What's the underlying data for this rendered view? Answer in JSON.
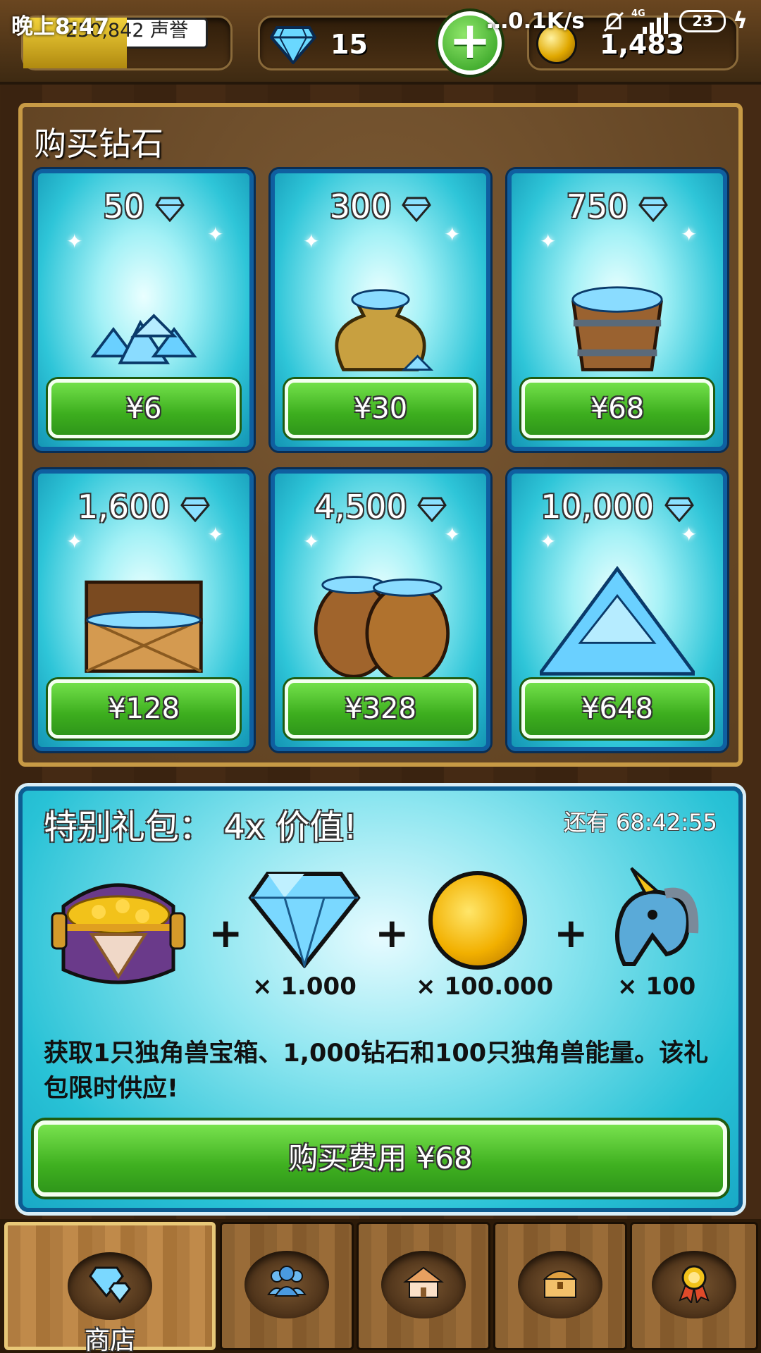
{
  "status_bar": {
    "time": "晚上8:47",
    "net_speed": "…0.1K/s",
    "network": "4G",
    "battery": "23"
  },
  "hud": {
    "reputation_value": "250,842",
    "reputation_label": "声誉",
    "reputation_progress": 0.5,
    "diamonds": "15",
    "coins": "1,483"
  },
  "shop": {
    "title": "购买钻石",
    "packs": [
      {
        "amount": "50",
        "price": "¥6",
        "art": "diamond-pile"
      },
      {
        "amount": "300",
        "price": "¥30",
        "art": "diamond-sack"
      },
      {
        "amount": "750",
        "price": "¥68",
        "art": "diamond-bucket"
      },
      {
        "amount": "1,600",
        "price": "¥128",
        "art": "treasure-chest"
      },
      {
        "amount": "4,500",
        "price": "¥328",
        "art": "barrels"
      },
      {
        "amount": "10,000",
        "price": "¥648",
        "art": "diamond-mountain"
      }
    ]
  },
  "special": {
    "title": "特别礼包：  4x 价值!",
    "timer": "还有 68:42:55",
    "items": [
      {
        "icon": "unicorn-chest-icon",
        "qty": ""
      },
      {
        "icon": "diamond-icon",
        "qty": "× 1.000"
      },
      {
        "icon": "gold-coin-icon",
        "qty": "× 100.000"
      },
      {
        "icon": "unicorn-icon",
        "qty": "× 100"
      }
    ],
    "description": "获取1只独角兽宝箱、1,000钻石和100只独角兽能量。该礼包限时供应!",
    "buy_label": "购买费用 ¥68"
  },
  "nav": {
    "tabs": [
      {
        "icon": "shop-diamond-icon",
        "label": "商店",
        "active": true
      },
      {
        "icon": "people-icon",
        "label": "",
        "active": false
      },
      {
        "icon": "houses-icon",
        "label": "",
        "active": false
      },
      {
        "icon": "chest-icon",
        "label": "",
        "active": false
      },
      {
        "icon": "medal-icon",
        "label": "",
        "active": false
      }
    ]
  },
  "colors": {
    "accent_green": "#3dae1e",
    "card_teal": "#2ec5d8",
    "card_border": "#0f5fa0",
    "wood": "#5b3e1f"
  }
}
